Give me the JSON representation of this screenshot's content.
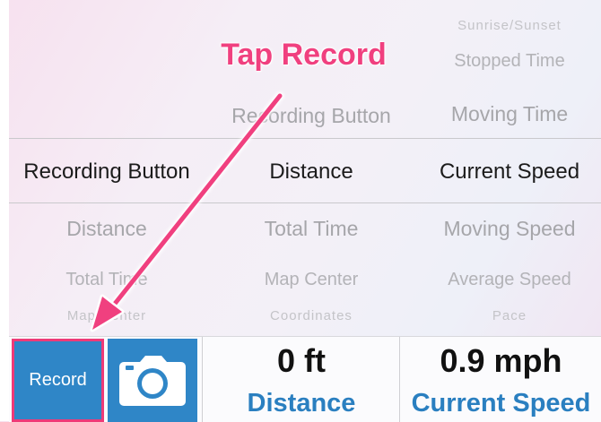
{
  "callout": "Tap Record",
  "picker": {
    "col1": {
      "items": [
        "Recording Button",
        "Distance",
        "Total Time",
        "Map Center"
      ],
      "selected_index": 0
    },
    "col2": {
      "items": [
        "Recording Button",
        "Distance",
        "Total Time",
        "Map Center",
        "Coordinates"
      ],
      "selected_index": 1
    },
    "col3": {
      "items": [
        "Sunrise/Sunset",
        "Stopped Time",
        "Moving Time",
        "Current Speed",
        "Moving Speed",
        "Average Speed",
        "Pace"
      ],
      "selected_index": 3
    }
  },
  "toolbar": {
    "record_label": "Record",
    "camera_icon": "camera-icon",
    "stats": [
      {
        "value": "0 ft",
        "label": "Distance"
      },
      {
        "value": "0.9 mph",
        "label": "Current Speed"
      }
    ]
  },
  "colors": {
    "accent_blue": "#2f86c7",
    "label_blue": "#2a7fc0",
    "annotation_pink": "#f0407f"
  }
}
